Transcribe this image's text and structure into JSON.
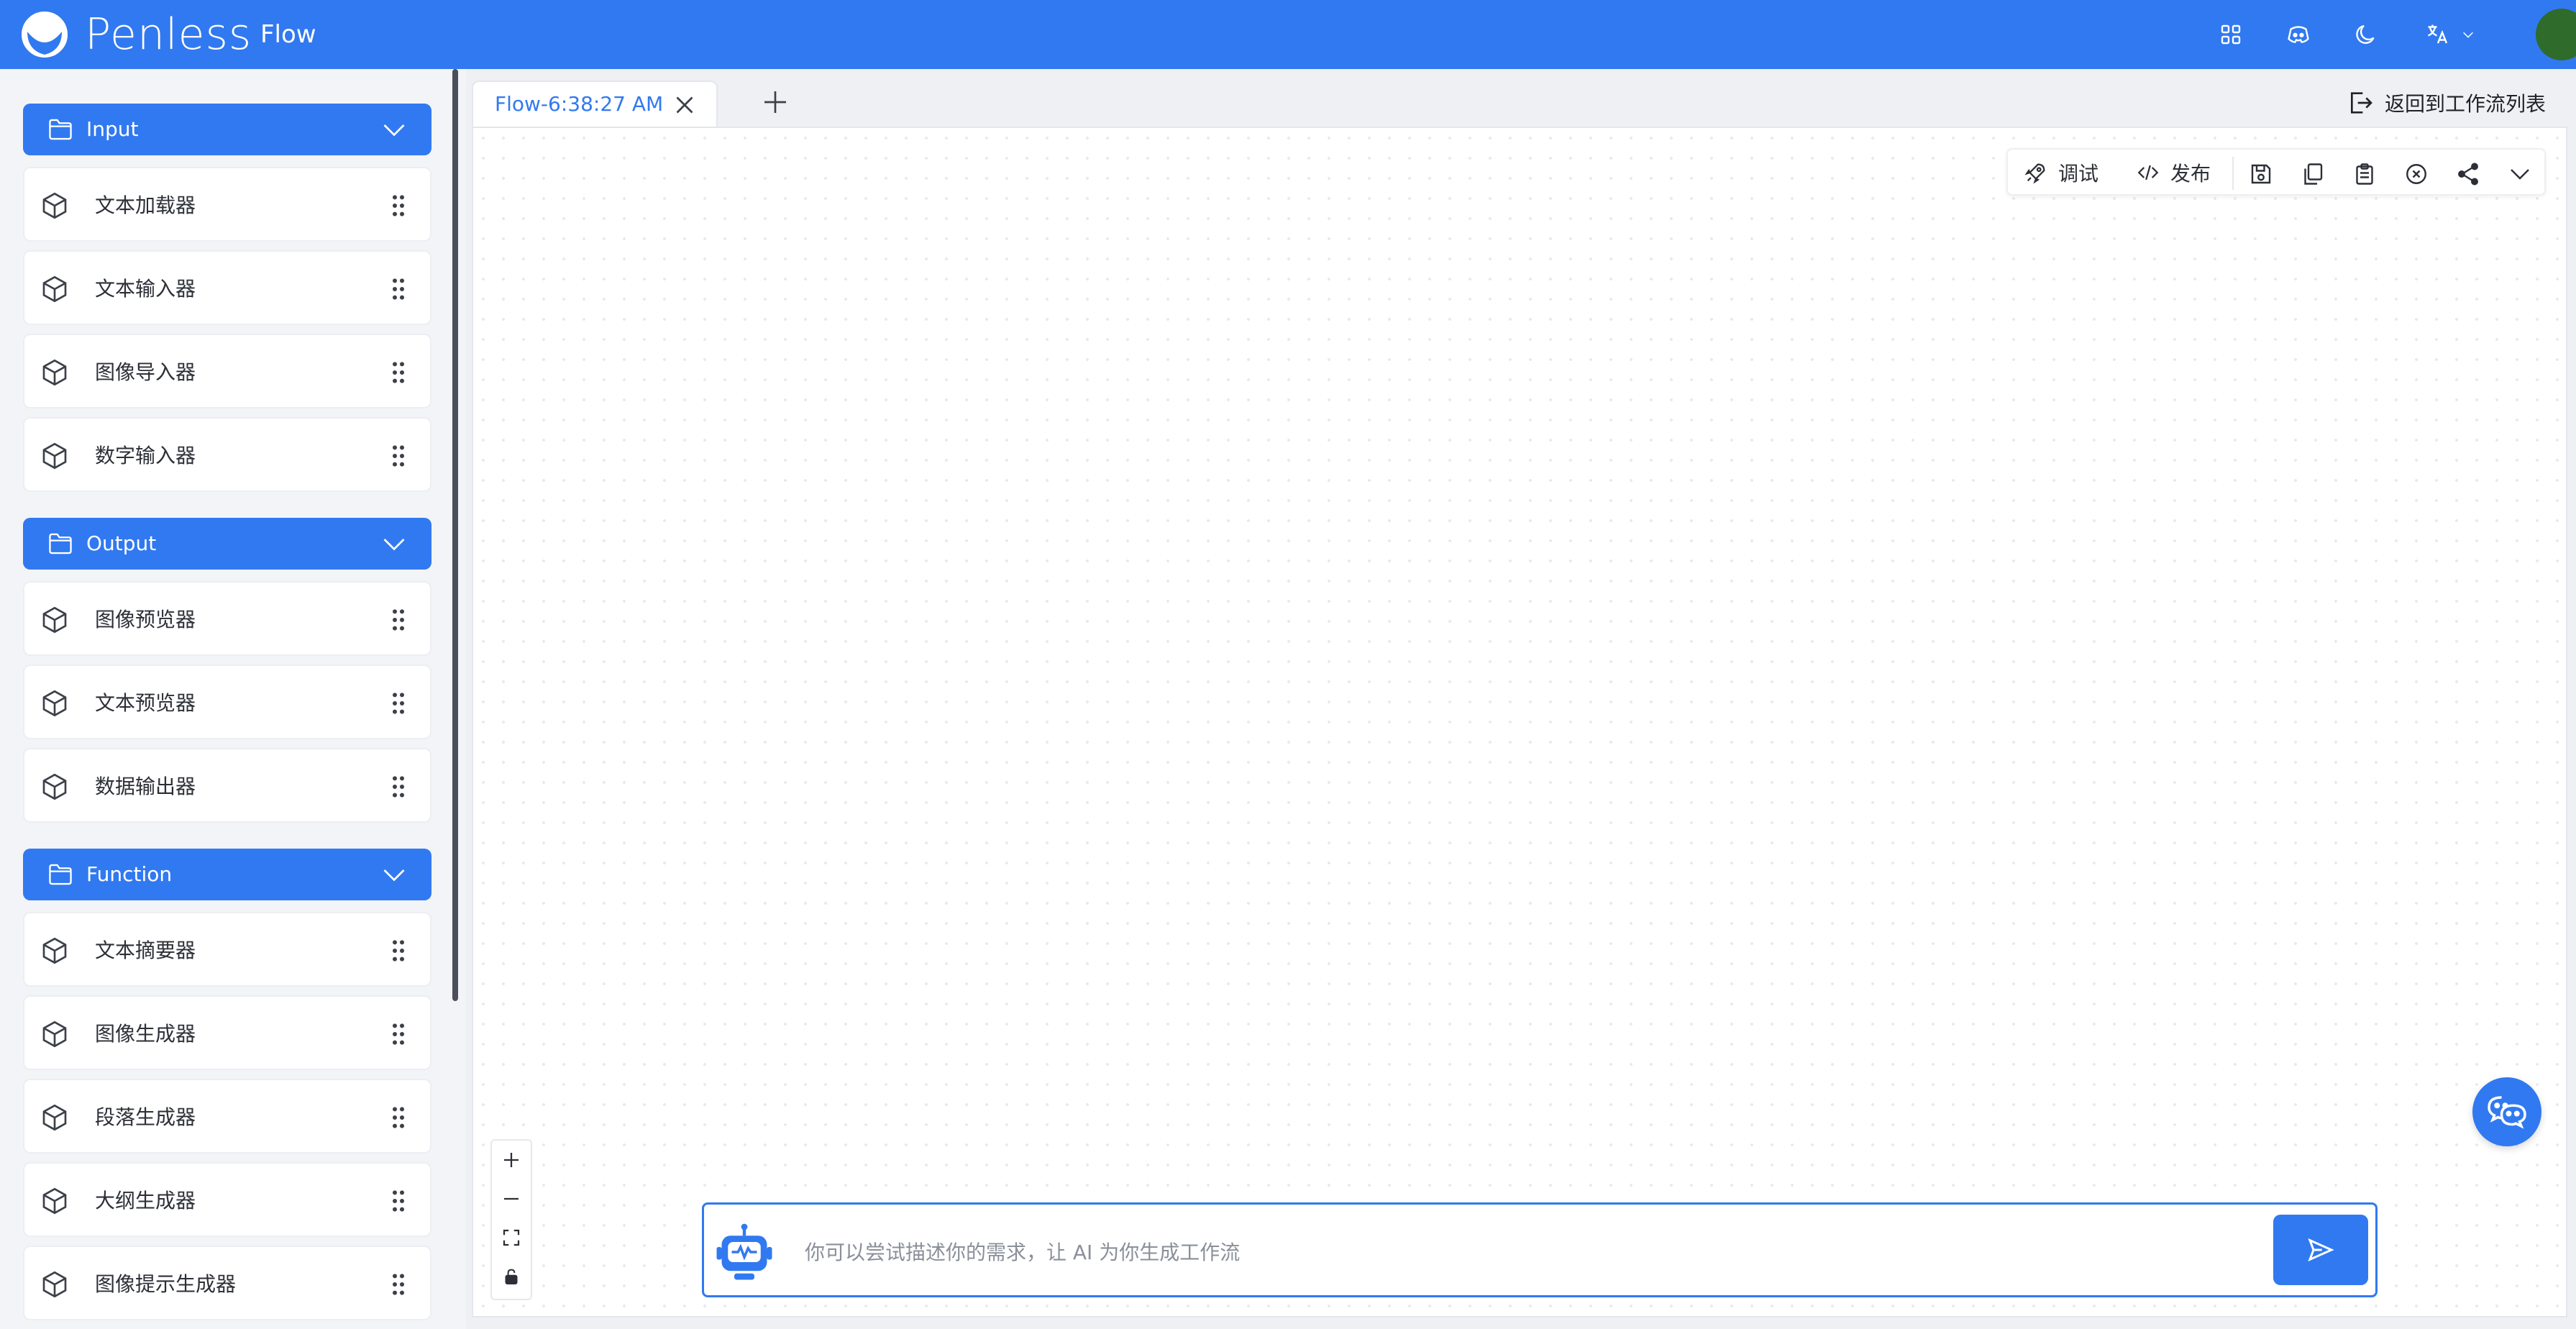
{
  "header": {
    "brand": "Penless",
    "product": "Flow",
    "icons": [
      "apps-icon",
      "discord-icon",
      "moon-icon",
      "translate-icon"
    ],
    "accent_color": "#3179f0"
  },
  "sidebar": {
    "groups": [
      {
        "label": "Input",
        "items": [
          {
            "label": "文本加载器"
          },
          {
            "label": "文本输入器"
          },
          {
            "label": "图像导入器"
          },
          {
            "label": "数字输入器"
          }
        ]
      },
      {
        "label": "Output",
        "items": [
          {
            "label": "图像预览器"
          },
          {
            "label": "文本预览器"
          },
          {
            "label": "数据输出器"
          }
        ]
      },
      {
        "label": "Function",
        "items": [
          {
            "label": "文本摘要器"
          },
          {
            "label": "图像生成器"
          },
          {
            "label": "段落生成器"
          },
          {
            "label": "大纲生成器"
          },
          {
            "label": "图像提示生成器"
          }
        ]
      }
    ]
  },
  "tabs": [
    {
      "title": "Flow-6:38:27 AM",
      "active": true
    }
  ],
  "back_label": "返回到工作流列表",
  "toolbar": {
    "debug_label": "调试",
    "publish_label": "发布",
    "icons": [
      "save-icon",
      "copy-icon",
      "clipboard-icon",
      "clear-icon",
      "share-icon",
      "chevron-down-icon"
    ]
  },
  "zoom_controls": [
    "zoom-in-icon",
    "zoom-out-icon",
    "fit-view-icon",
    "lock-icon"
  ],
  "ai_prompt": {
    "placeholder": "你可以尝试描述你的需求，让 AI 为你生成工作流"
  }
}
